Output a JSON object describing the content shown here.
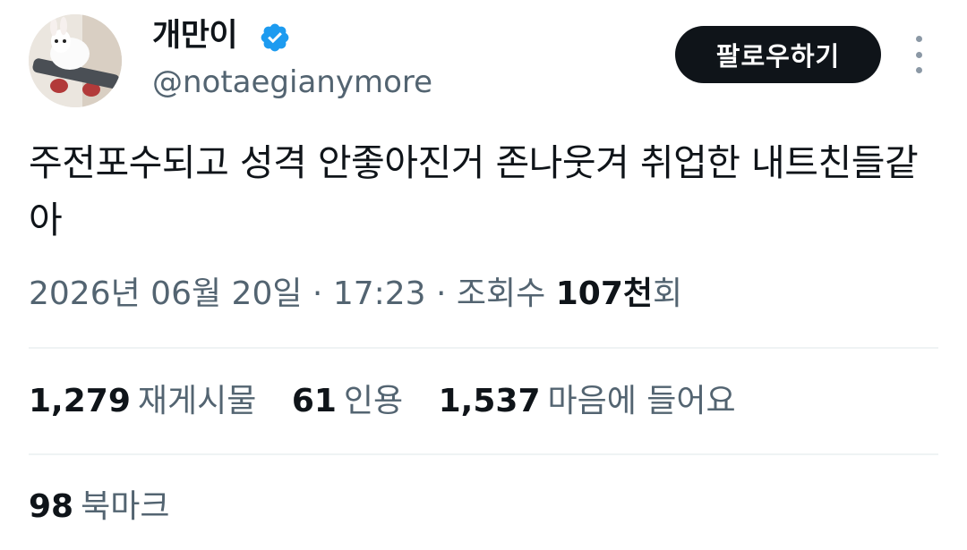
{
  "author": {
    "display_name": "개만이",
    "handle": "@notaegianymore",
    "verified_icon": "verified-badge-icon",
    "verified_color": "#1d9bf0"
  },
  "follow_label": "팔로우하기",
  "more_icon": "more-vertical-icon",
  "tweet": {
    "text": "주전포수되고 성격 안좋아진거 존나웃겨 취업한 내트친들같아"
  },
  "meta": {
    "date": "2026년 06월 20일",
    "sep1": " · ",
    "time": "17:23",
    "sep2": " · ",
    "views_label": "조회수 ",
    "views_count": "107천",
    "views_suffix": "회"
  },
  "stats": {
    "retweets_count": "1,279",
    "retweets_label": "재게시물",
    "quotes_count": "61",
    "quotes_label": "인용",
    "likes_count": "1,537",
    "likes_label": "마음에 들어요"
  },
  "bookmarks": {
    "count": "98",
    "label": "북마크"
  }
}
